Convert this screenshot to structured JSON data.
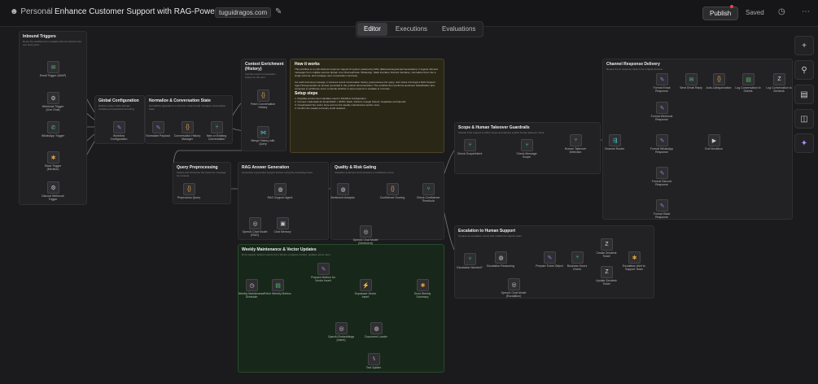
{
  "topbar": {
    "user": "Personal",
    "title": "Enhance Customer Support with RAG-Powered AI",
    "tag": "tuguidragos.com",
    "publish": "Publish",
    "saved": "Saved"
  },
  "tabs": [
    "Editor",
    "Executions",
    "Evaluations"
  ],
  "toolbar": [
    "plus-icon",
    "search-icon",
    "file-icon",
    "panel-icon",
    "sparkle-icon"
  ],
  "groups": {
    "inbound": {
      "title": "Inbound Triggers",
      "desc": "Route the workflow from multiple inbound channel into one entry point."
    },
    "global": {
      "title": "Global Configuration",
      "desc": "Defines system wide settings, confidence threshold and routing."
    },
    "normalize": {
      "title": "Normalize & Conversation State",
      "desc": "Normalizes payloads to a common schema and manages conversation state."
    },
    "context": {
      "title": "Context Enrichment (History)",
      "desc": "Fetches recent conversation history for the user."
    },
    "howit": {
      "title": "How it works",
      "p1": "This workflow is a multi-channel customer support AI system powered by RAG (Retrieval-Augmented Generation). It ingests inbound messages from multiple sources (Email, Live Chat webhook, WhatsApp, Slack interface, Discord interface), normalizes them into a single schema, and manages user conversation continuity.",
      "p2": "For each incoming message, it retrieves recent conversation history, preprocesses the query, and routes it through a RAG Support Agent that generates an answer grounded in the product documentation. The workflow then performs sentiment classification and computes a confidence score to decide whether to auto-respond or escalate to a human.",
      "setup": "Setup steps",
      "s1": "1. Populate environment variables used in Workflow Configuration.",
      "s2": "2. Connect credentials for Email IMAP + SMTP, Slack, Discord, Google Sheets, Supabase and OpenAI.",
      "s3": "3. Create/select the vector store and run the weekly maintenance section once.",
      "s4": "4. Confirm the weekly summary email recipient."
    },
    "query": {
      "title": "Query Preprocessing",
      "desc": "Cleans and structures the customer message for retrieval."
    },
    "rag": {
      "title": "RAG Answer Generation",
      "desc": "Generates a grounded support answer using the knowledge base."
    },
    "quality": {
      "title": "Quality & Risk Gating",
      "desc": "Classifies sentiment and computes a confidence score."
    },
    "scope": {
      "title": "Scope & Human Takeover Guardrails",
      "desc": "Checks if the request is within scope and detects explicit human takeover intent."
    },
    "channel": {
      "title": "Channel Response Delivery",
      "desc": "Routes the AI response back to the original channel."
    },
    "escalation": {
      "title": "Escalation to Human Support",
      "desc": "Creates an escalation record and notifies the support team."
    },
    "weekly": {
      "title": "Weekly Maintenance & Vector Updates",
      "desc": "Runs weekly: fetches metrics from Sheets, prepares content, updates vector store."
    }
  },
  "nodes": [
    {
      "id": "email",
      "label": "Email Trigger (IMAP)",
      "icon": "✉",
      "color": "#5fbf6a"
    },
    {
      "id": "webhook",
      "label": "Webhook Trigger (Live Chat)",
      "icon": "⚙",
      "color": "#ccc"
    },
    {
      "id": "whatsapp",
      "label": "WhatsApp Trigger",
      "icon": "✆",
      "color": "#4fc167"
    },
    {
      "id": "slack",
      "label": "Slack Trigger (Mention)",
      "icon": "✱",
      "color": "#e0a040"
    },
    {
      "id": "discord",
      "label": "Discord Webhook Trigger",
      "icon": "⚙",
      "color": "#ccc"
    },
    {
      "id": "wfconfig",
      "label": "Workflow Configuration",
      "icon": "✎",
      "color": "#9a7bd8"
    },
    {
      "id": "normalize",
      "label": "Normalize Payload",
      "icon": "✎",
      "color": "#9a7bd8"
    },
    {
      "id": "convhist",
      "label": "Conversation History Manager",
      "icon": "{}",
      "color": "#e0a040"
    },
    {
      "id": "newconv",
      "label": "New or Existing Conversation",
      "icon": "⑂",
      "color": "#4fc167"
    },
    {
      "id": "fetchconv",
      "label": "Fetch Conversation History",
      "icon": "{}",
      "color": "#e0a040"
    },
    {
      "id": "merge",
      "label": "Merge History with Query",
      "icon": "⋈",
      "color": "#4fc1c1"
    },
    {
      "id": "preprocess",
      "label": "Preprocess Query",
      "icon": "{}",
      "color": "#e0a040"
    },
    {
      "id": "ragagent",
      "label": "RAG Support Agent",
      "icon": "◍",
      "color": "#ccc"
    },
    {
      "id": "openai1",
      "label": "OpenAI Chat Model (RAG)",
      "icon": "◎",
      "color": "#ccc"
    },
    {
      "id": "chatmem",
      "label": "Chat Memory",
      "icon": "▣",
      "color": "#ccc"
    },
    {
      "id": "sentiment",
      "label": "Sentiment Analysis",
      "icon": "◍",
      "color": "#ccc"
    },
    {
      "id": "confscore",
      "label": "Confidence Scoring",
      "icon": "{}",
      "color": "#e0a040"
    },
    {
      "id": "confcheck",
      "label": "Check Confidence Threshold",
      "icon": "⑂",
      "color": "#4fc167"
    },
    {
      "id": "openai2",
      "label": "OpenAI Chat Model (Sentiment)",
      "icon": "◎",
      "color": "#ccc"
    },
    {
      "id": "scopecheck",
      "label": "Check Scope/Intent",
      "icon": "⑂",
      "color": "#4fc167"
    },
    {
      "id": "msgscope",
      "label": "Check Message Scope",
      "icon": "⑂",
      "color": "#4fc167"
    },
    {
      "id": "takeover",
      "label": "Human Takeover Detection",
      "icon": "⑂",
      "color": "#4fc167"
    },
    {
      "id": "chanrouter",
      "label": "Channel Router",
      "icon": "⇶",
      "color": "#4fc1c1"
    },
    {
      "id": "fmtemail",
      "label": "Format Email Response",
      "icon": "✎",
      "color": "#9a7bd8"
    },
    {
      "id": "sendemail",
      "label": "Send Email Reply",
      "icon": "✉",
      "color": "#5fbf6a"
    },
    {
      "id": "autocat",
      "label": "Auto-Categorization",
      "icon": "⑂",
      "color": "#4fc167"
    },
    {
      "id": "autocat2",
      "label": "Auto-Categorization",
      "icon": "{}",
      "color": "#e0a040"
    },
    {
      "id": "logsheets",
      "label": "Log Conversation to Sheets",
      "icon": "▤",
      "color": "#4fc167"
    },
    {
      "id": "logzendesk",
      "label": "Log Conversation to Zendesk",
      "icon": "Z",
      "color": "#ddd"
    },
    {
      "id": "fmtwebhook",
      "label": "Format Webhook Response",
      "icon": "✎",
      "color": "#9a7bd8"
    },
    {
      "id": "fmtwhatsapp",
      "label": "Format WhatsApp Response",
      "icon": "✎",
      "color": "#9a7bd8"
    },
    {
      "id": "fmtdiscord",
      "label": "Format Discord Response",
      "icon": "✎",
      "color": "#9a7bd8"
    },
    {
      "id": "fmtslack",
      "label": "Format Slack Response",
      "icon": "✎",
      "color": "#9a7bd8"
    },
    {
      "id": "endflow",
      "label": "End Workflow",
      "icon": "▶",
      "color": "#ccc"
    },
    {
      "id": "escneeded",
      "label": "Escalation Needed?",
      "icon": "⑂",
      "color": "#4fc167"
    },
    {
      "id": "escreason",
      "label": "Escalation Reasoning",
      "icon": "◍",
      "color": "#ccc"
    },
    {
      "id": "prepobj",
      "label": "Prepare Ticket Object",
      "icon": "✎",
      "color": "#9a7bd8"
    },
    {
      "id": "bizhours",
      "label": "Business Hours Check",
      "icon": "⑂",
      "color": "#4fc167"
    },
    {
      "id": "createzd",
      "label": "Create Zendesk Ticket",
      "icon": "Z",
      "color": "#ddd"
    },
    {
      "id": "updatezd",
      "label": "Update Zendesk Ticket",
      "icon": "Z",
      "color": "#ddd"
    },
    {
      "id": "escalert",
      "label": "Escalation Alert to Support Team",
      "icon": "✱",
      "color": "#e0a040"
    },
    {
      "id": "openai3",
      "label": "OpenAI Chat Model (Escalation)",
      "icon": "◎",
      "color": "#ccc"
    },
    {
      "id": "weeksched",
      "label": "Weekly Maintenance Schedule",
      "icon": "◷",
      "color": "#ccc"
    },
    {
      "id": "fetchweekly",
      "label": "Fetch Weekly Metrics",
      "icon": "▤",
      "color": "#4fc167"
    },
    {
      "id": "prepvec",
      "label": "Prepare Metrics for Vector Insert",
      "icon": "✎",
      "color": "#9a7bd8"
    },
    {
      "id": "supavec",
      "label": "Supabase Vector Insert",
      "icon": "⚡",
      "color": "#4fc167"
    },
    {
      "id": "sendsummary",
      "label": "Send Weekly Summary",
      "icon": "✱",
      "color": "#e0a040"
    },
    {
      "id": "openaiemb",
      "label": "OpenAI Embeddings (Insert)",
      "icon": "◎",
      "color": "#ccc"
    },
    {
      "id": "docloader",
      "label": "Document Loader",
      "icon": "◍",
      "color": "#ccc"
    },
    {
      "id": "textsplit",
      "label": "Text Splitter",
      "icon": "⑊",
      "color": "#ccc"
    }
  ]
}
